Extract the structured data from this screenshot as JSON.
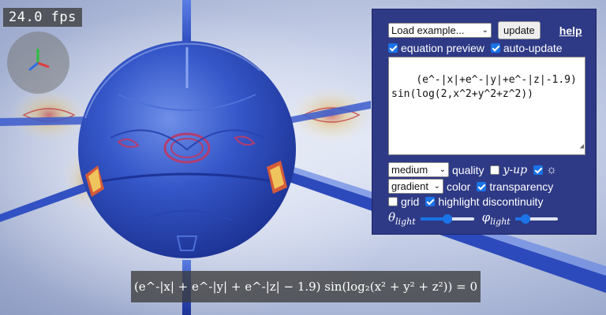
{
  "fps": "24.0 fps",
  "panel": {
    "example_select": "Load example...",
    "update_button": "update",
    "help_link": "help",
    "equation_preview": {
      "label": "equation preview",
      "checked": true
    },
    "auto_update": {
      "label": "auto-update",
      "checked": true
    },
    "equation_text": "(e^-|x|+e^-|y|+e^-|z|-1.9)sin(log(2,x^2+y^2+z^2))",
    "quality_select": "medium",
    "quality_label": "quality",
    "y_up": {
      "label": "y-up",
      "checked": false
    },
    "light_toggle": {
      "glyph": "☼",
      "checked": true
    },
    "color_select": "gradient",
    "color_label": "color",
    "transparency": {
      "label": "transparency",
      "checked": true
    },
    "grid": {
      "label": "grid",
      "checked": false
    },
    "highlight_discontinuity": {
      "label": "highlight discontinuity",
      "checked": true
    },
    "theta_light": {
      "symbol": "θ",
      "subscript": "light",
      "value": 0.5
    },
    "phi_light": {
      "symbol": "φ",
      "subscript": "light",
      "value": 0.25
    }
  },
  "rendered_equation": "(e^-|x| + e^-|y| + e^-|z| − 1.9) sin(log₂(x² + y² + z²)) = 0",
  "colors": {
    "panel_bg": "#2e3a86",
    "accent": "#1a73e8",
    "surface": "#3557c9"
  }
}
